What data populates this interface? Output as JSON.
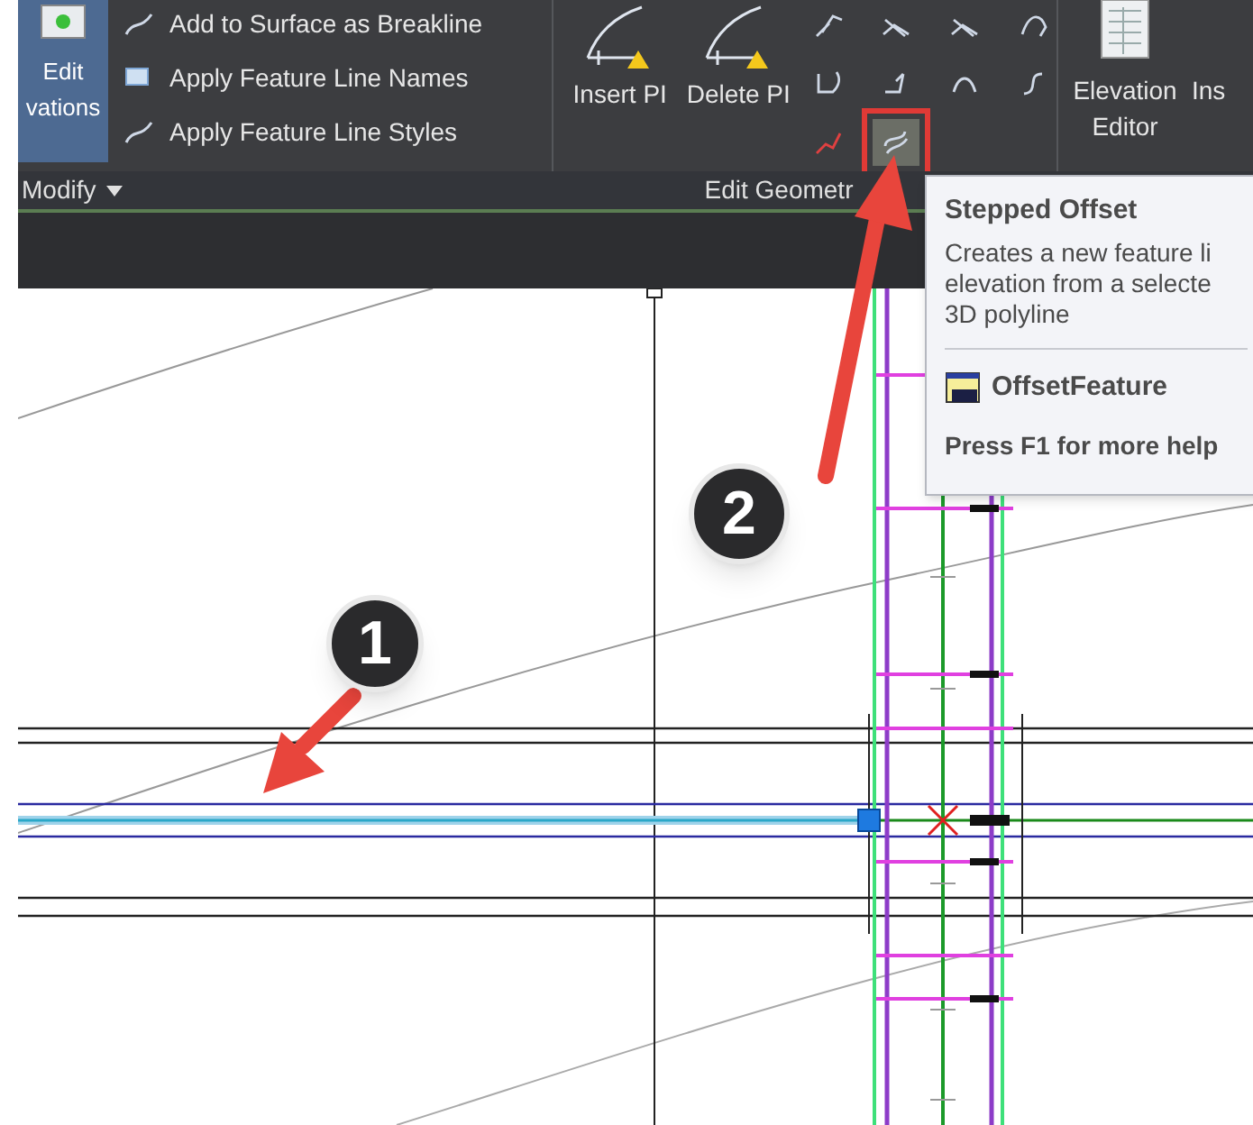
{
  "ribbon": {
    "modify_panel": {
      "edit_elevations": {
        "line_1": "Edit",
        "line_2": "vations"
      },
      "commands": [
        {
          "label": "Add to Surface as Breakline"
        },
        {
          "label": "Apply Feature Line Names"
        },
        {
          "label": "Apply Feature Line Styles"
        }
      ],
      "label": "Modify"
    },
    "edit_geometry_panel": {
      "buttons": [
        {
          "label": "Insert PI"
        },
        {
          "label": "Delete PI"
        }
      ],
      "tools": [
        {
          "highlighted": false
        },
        {
          "highlighted": false
        },
        {
          "highlighted": false
        },
        {
          "highlighted": false
        },
        {
          "highlighted": false
        },
        {
          "highlighted": false
        },
        {
          "highlighted": false
        },
        {
          "highlighted": false
        },
        {
          "highlighted": false
        },
        {
          "highlighted": true
        }
      ],
      "label": "Edit Geometr"
    },
    "elevation_editor": {
      "line_1": "Elevation",
      "line_2": "Editor"
    },
    "next_button": {
      "label": "Ins"
    }
  },
  "tooltip": {
    "title": "Stepped Offset",
    "description": [
      "Creates a new feature li",
      "elevation from a selecte",
      "3D polyline"
    ],
    "command": "OffsetFeature",
    "help": "Press F1 for more help"
  },
  "markers": [
    {
      "number": "1"
    },
    {
      "number": "2"
    }
  ]
}
